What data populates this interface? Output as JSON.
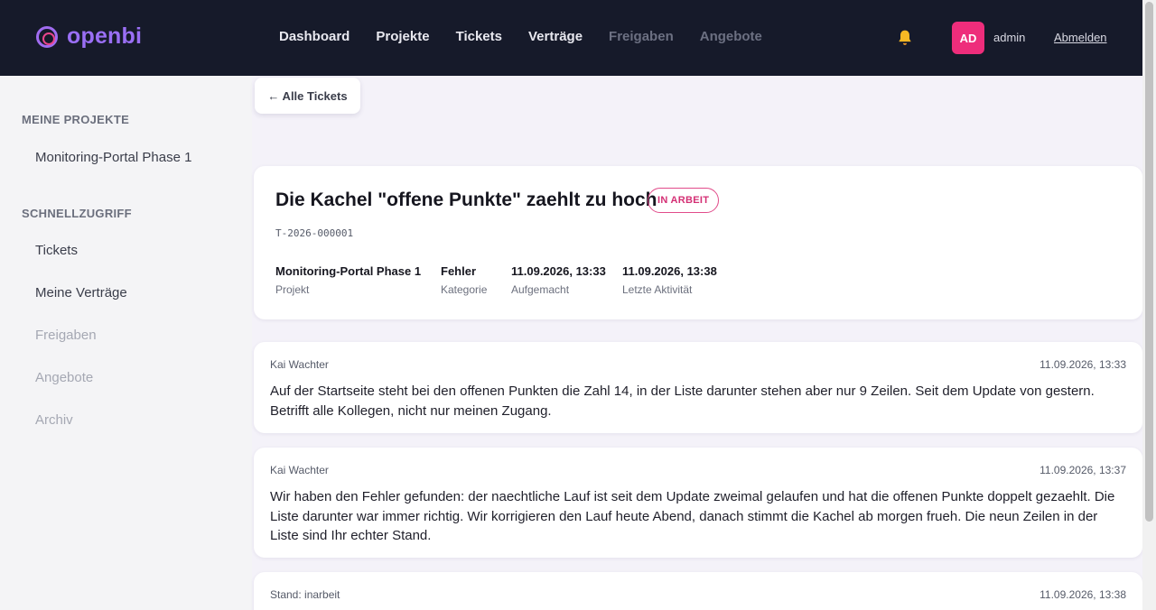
{
  "brand": {
    "name": "openbi"
  },
  "nav": {
    "items": [
      {
        "label": "Dashboard",
        "dim": false
      },
      {
        "label": "Projekte",
        "dim": false
      },
      {
        "label": "Tickets",
        "dim": false
      },
      {
        "label": "Verträge",
        "dim": false
      },
      {
        "label": "Freigaben",
        "dim": true
      },
      {
        "label": "Angebote",
        "dim": true
      }
    ]
  },
  "user": {
    "initials": "AD",
    "name": "admin",
    "logout_label": "Abmelden"
  },
  "sidebar": {
    "section_projects": "MEINE PROJEKTE",
    "projects": [
      "Monitoring-Portal Phase 1"
    ],
    "section_quick": "SCHNELLZUGRIFF",
    "quick": [
      {
        "label": "Tickets",
        "dim": false
      },
      {
        "label": "Meine Verträge",
        "dim": false
      },
      {
        "label": "Freigaben",
        "dim": true
      },
      {
        "label": "Angebote",
        "dim": true
      },
      {
        "label": "Archiv",
        "dim": true
      }
    ]
  },
  "back_label": "← Alle Tickets",
  "ticket": {
    "title": "Die Kachel \"offene Punkte\" zaehlt zu hoch",
    "status": "IN ARBEIT",
    "id": "T-2026-000001",
    "meta": [
      {
        "value": "Monitoring-Portal Phase 1",
        "label": "Projekt"
      },
      {
        "value": "Fehler",
        "label": "Kategorie"
      },
      {
        "value": "11.09.2026, 13:33",
        "label": "Aufgemacht"
      },
      {
        "value": "11.09.2026, 13:38",
        "label": "Letzte Aktivität"
      }
    ]
  },
  "messages": [
    {
      "author": "Kai Wachter",
      "time": "11.09.2026, 13:33",
      "text": "Auf der Startseite steht bei den offenen Punkten die Zahl 14, in der Liste darunter stehen aber nur 9 Zeilen. Seit dem Update von gestern. Betrifft alle Kollegen, nicht nur meinen Zugang."
    },
    {
      "author": "Kai Wachter",
      "time": "11.09.2026, 13:37",
      "text": "Wir haben den Fehler gefunden: der naechtliche Lauf ist seit dem Update zweimal gelaufen und hat die offenen Punkte doppelt gezaehlt. Die Liste darunter war immer richtig. Wir korrigieren den Lauf heute Abend, danach stimmt die Kachel ab morgen frueh. Die neun Zeilen in der Liste sind Ihr echter Stand."
    },
    {
      "author": "Stand: inarbeit",
      "time": "11.09.2026, 13:38",
      "text": ""
    }
  ]
}
